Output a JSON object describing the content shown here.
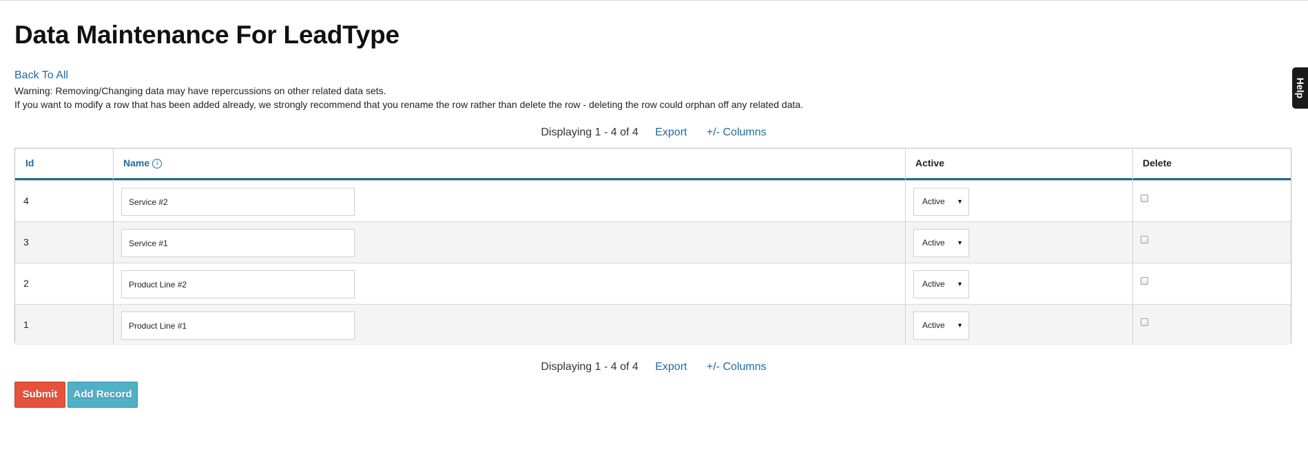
{
  "page": {
    "title": "Data Maintenance For LeadType",
    "back_link": "Back To All",
    "warning_line1": "Warning: Removing/Changing data may have repercussions on other related data sets.",
    "warning_line2": "If you want to modify a row that has been added already, we strongly recommend that you rename the row rather than delete the row - deleting the row could orphan off any related data."
  },
  "pager": {
    "info": "Displaying 1 - 4 of 4",
    "export_label": "Export",
    "columns_label": "+/- Columns"
  },
  "grid": {
    "headers": {
      "id": "Id",
      "name": "Name",
      "active": "Active",
      "delete": "Delete"
    },
    "rows": [
      {
        "id": "4",
        "name": "Service #2",
        "status": "Active"
      },
      {
        "id": "3",
        "name": "Service #1",
        "status": "Active"
      },
      {
        "id": "2",
        "name": "Product Line #2",
        "status": "Active"
      },
      {
        "id": "1",
        "name": "Product Line #1",
        "status": "Active"
      }
    ]
  },
  "buttons": {
    "submit": "Submit",
    "add_record": "Add Record"
  },
  "help_tab": "Help",
  "colors": {
    "link": "#1f6aa0",
    "header_rule": "#1e6a96",
    "submit_bg": "#e6533b",
    "add_bg": "#4fb0c6"
  }
}
